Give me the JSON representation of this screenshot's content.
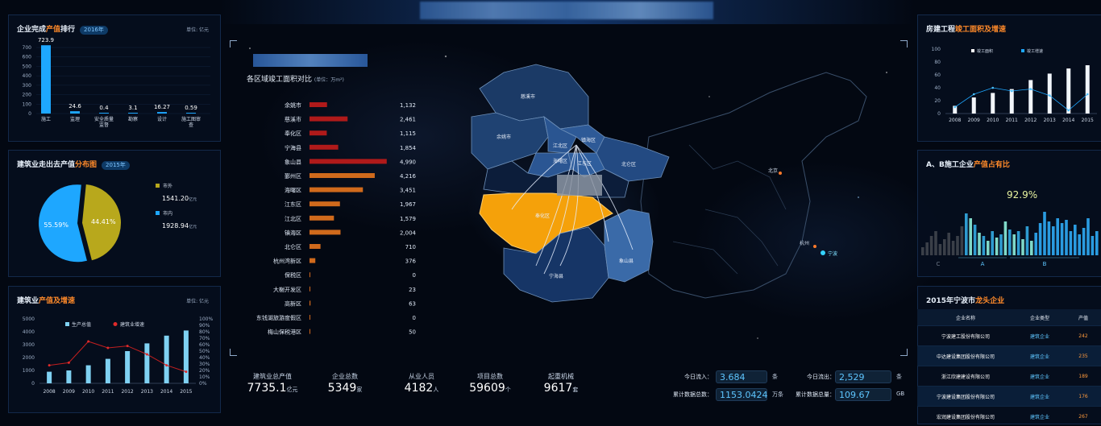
{
  "header": {
    "title_redacted": true
  },
  "output_rank": {
    "title_pre": "企业完成",
    "title_hl": "产值",
    "title_post": "排行",
    "year": "2016年",
    "unit": "单位: 亿元",
    "chart_data": {
      "type": "bar",
      "categories": [
        "施工",
        "监理",
        "安全质量监督",
        "勘察",
        "设计",
        "施工图审查"
      ],
      "values": [
        723.9,
        24.6,
        0.4,
        3.1,
        16.27,
        0.59
      ],
      "value_labels": [
        "723.9",
        "24.6",
        "0.4",
        "3.1",
        "16.27",
        "0.59"
      ],
      "ylim": [
        0,
        700
      ],
      "yticks": [
        0,
        100,
        200,
        300,
        400,
        500,
        600,
        700
      ],
      "color": "#1ea7ff"
    }
  },
  "distribution": {
    "title_pre": "建筑业走出去产值",
    "title_hl": "分布图",
    "year": "2015年",
    "chart_data": {
      "type": "pie",
      "slices": [
        {
          "name": "市外",
          "value": 1541.2,
          "percent": "44.41%",
          "color": "#b8a81c"
        },
        {
          "name": "市内",
          "value": 1928.94,
          "percent": "55.59%",
          "color": "#1ea7ff"
        }
      ]
    },
    "legend": [
      {
        "name": "市外",
        "value": "1541.20",
        "unit": "亿元"
      },
      {
        "name": "市内",
        "value": "1928.94",
        "unit": "亿元"
      }
    ]
  },
  "growth": {
    "title_pre": "建筑业",
    "title_hl": "产值及增速",
    "unit": "单位: 亿元",
    "legend": [
      "生产总值",
      "建筑业增速"
    ],
    "chart_data": {
      "type": "bar+line",
      "categories": [
        "2008",
        "2009",
        "2010",
        "2011",
        "2012",
        "2013",
        "2014",
        "2015"
      ],
      "bars": [
        900,
        1000,
        1400,
        1900,
        2500,
        3100,
        3700,
        4100
      ],
      "line": [
        28,
        32,
        65,
        55,
        58,
        45,
        28,
        18
      ],
      "ylim": [
        0,
        5000
      ],
      "yticks": [
        0,
        500,
        1000,
        1500,
        2000,
        2500,
        3000,
        3500,
        4000,
        4500,
        5000
      ],
      "y2lim": [
        0,
        100
      ],
      "y2ticks": [
        "0%",
        "10%",
        "20%",
        "30%",
        "40%",
        "50%",
        "60%",
        "70%",
        "80%",
        "90%",
        "100%"
      ]
    }
  },
  "area_compare": {
    "title": "各区域竣工面积对比",
    "unit": "(单位：万m²)",
    "chart_data": {
      "type": "bar",
      "categories": [
        "余姚市",
        "慈溪市",
        "奉化区",
        "宁海县",
        "象山县",
        "鄞州区",
        "海曙区",
        "江东区",
        "江北区",
        "镇海区",
        "北仑区",
        "杭州湾新区",
        "保税区",
        "大榭开发区",
        "高新区",
        "东钱湖旅游度假区",
        "梅山保税港区"
      ],
      "values": [
        1132,
        2461,
        1115,
        1854,
        4990,
        4216,
        3451,
        1967,
        1579,
        2004,
        710,
        376,
        0,
        23,
        63,
        0,
        50
      ],
      "value_labels": [
        "1,132",
        "2,461",
        "1,115",
        "1,854",
        "4,990",
        "4,216",
        "3,451",
        "1,967",
        "1,579",
        "2,004",
        "710",
        "376",
        "0",
        "23",
        "63",
        "0",
        "50"
      ],
      "colors": [
        "#b01a1a",
        "#b01a1a",
        "#b01a1a",
        "#b01a1a",
        "#b01a1a",
        "#d06a1c",
        "#d06a1c",
        "#d06a1c",
        "#d06a1c",
        "#d06a1c",
        "#d06a1c",
        "#d06a1c",
        "#d06a1c",
        "#d06a1c",
        "#d06a1c",
        "#d06a1c",
        "#d06a1c"
      ]
    }
  },
  "map": {
    "regions": [
      "慈溪市",
      "余姚市",
      "江北区",
      "镇海区",
      "海曙区",
      "江东区",
      "北仑区",
      "奉化区",
      "宁海县",
      "象山县"
    ],
    "cities": [
      "北京",
      "杭州",
      "宁波"
    ]
  },
  "stats": [
    {
      "label": "建筑业总产值",
      "value": "7735.1",
      "unit": "亿元"
    },
    {
      "label": "企业总数",
      "value": "5349",
      "unit": "家"
    },
    {
      "label": "从业人员",
      "value": "4182",
      "unit": "人"
    },
    {
      "label": "项目总数",
      "value": "59609",
      "unit": "个"
    },
    {
      "label": "起重机械",
      "value": "9617",
      "unit": "套"
    }
  ],
  "flows": {
    "today_in_label": "今日流入：",
    "today_in": "3.684",
    "today_in_unit": "条",
    "today_out_label": "今日流出：",
    "today_out": "2,529",
    "today_out_unit": "条",
    "total_label": "累计数据总数：",
    "total": "1153.0424",
    "total_unit": "万条",
    "size_label": "累计数据总量：",
    "size": "109.67",
    "size_unit": "GB"
  },
  "completion": {
    "title_pre": "房建工程",
    "title_hl": "竣工面积及增速",
    "legend": [
      "竣工面积",
      "竣工增速"
    ],
    "chart_data": {
      "type": "bar+line",
      "categories": [
        "2008",
        "2009",
        "2010",
        "2011",
        "2012",
        "2013",
        "2014",
        "2015"
      ],
      "bars": [
        12,
        25,
        32,
        38,
        52,
        62,
        70,
        75
      ],
      "line": [
        10,
        30,
        40,
        35,
        38,
        28,
        5,
        30
      ],
      "ylim": [
        0,
        100
      ],
      "yticks": [
        0,
        20,
        40,
        60,
        80,
        100
      ]
    }
  },
  "ab_share": {
    "title_pre": "A、B施工企业",
    "title_hl": "产值占有比",
    "percent": "92.9%",
    "groups": [
      "C",
      "A",
      "B"
    ]
  },
  "leaders": {
    "title_pre": "2015年宁波市",
    "title_hl": "龙头企业",
    "columns": [
      "企业名称",
      "企业类型",
      "产值"
    ],
    "rows": [
      {
        "name": "宁波建工股份有限公司",
        "kind": "建筑企业",
        "value": "242"
      },
      {
        "name": "中达建设集团股份有限公司",
        "kind": "建筑企业",
        "value": "235"
      },
      {
        "name": "浙江欣建建设有限公司",
        "kind": "建筑企业",
        "value": "189"
      },
      {
        "name": "宁波建设集团股份有限公司",
        "kind": "建筑企业",
        "value": "176"
      },
      {
        "name": "宏润建设集团股份有限公司",
        "kind": "建筑企业",
        "value": "267"
      }
    ]
  }
}
